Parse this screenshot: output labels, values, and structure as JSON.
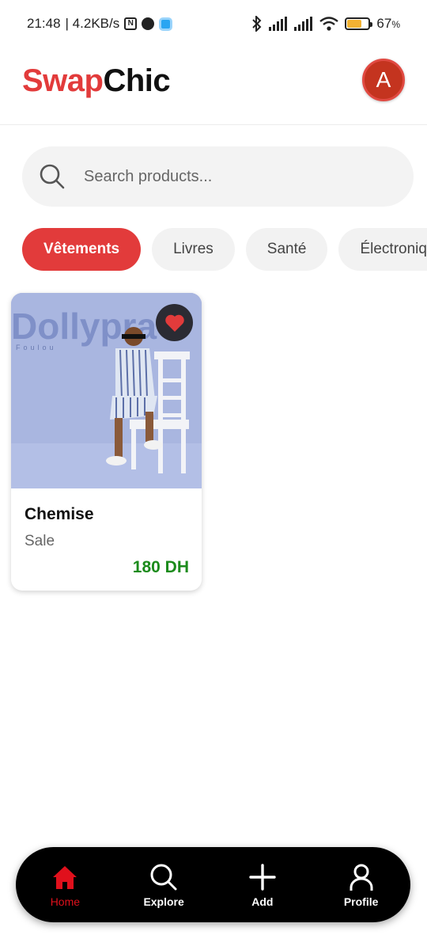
{
  "status_bar": {
    "time": "21:48",
    "network_speed": "| 4.2KB/s",
    "battery_percent": "67",
    "battery_suffix": "%",
    "battery_level": 0.67,
    "icons": [
      "nfc-icon",
      "app-notification-icon",
      "app-icon",
      "bluetooth-icon",
      "signal-icon",
      "signal-icon",
      "wifi-icon",
      "battery-icon"
    ]
  },
  "header": {
    "logo_part1": "Swap",
    "logo_part2": "Chic",
    "avatar_letter": "A"
  },
  "search": {
    "placeholder": "Search products..."
  },
  "categories": [
    {
      "label": "Vêtements",
      "active": true
    },
    {
      "label": "Livres",
      "active": false
    },
    {
      "label": "Santé",
      "active": false
    },
    {
      "label": "Électronique",
      "active": false
    }
  ],
  "products": [
    {
      "image_text": "Dollypra",
      "image_subtext": "Foulou",
      "title": "Chemise",
      "subtitle": "Sale",
      "price": "180 DH",
      "favorited": true
    }
  ],
  "bottom_nav": [
    {
      "label": "Home",
      "icon": "home-icon",
      "active": true
    },
    {
      "label": "Explore",
      "icon": "search-icon",
      "active": false
    },
    {
      "label": "Add",
      "icon": "plus-icon",
      "active": false
    },
    {
      "label": "Profile",
      "icon": "person-icon",
      "active": false
    }
  ],
  "colors": {
    "brand_red": "#e23b3b",
    "price_green": "#1c8b1c",
    "nav_active": "#e0101c",
    "nav_background": "#000000"
  }
}
